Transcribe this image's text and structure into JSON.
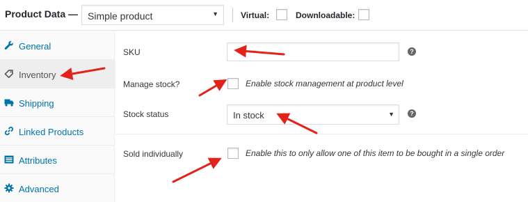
{
  "header": {
    "title": "Product Data —",
    "product_type": "Simple product",
    "virtual_label": "Virtual:",
    "downloadable_label": "Downloadable:"
  },
  "tabs": [
    {
      "label": "General",
      "icon": "wrench-icon"
    },
    {
      "label": "Inventory",
      "icon": "tag-icon"
    },
    {
      "label": "Shipping",
      "icon": "truck-icon"
    },
    {
      "label": "Linked Products",
      "icon": "link-icon"
    },
    {
      "label": "Attributes",
      "icon": "list-icon"
    },
    {
      "label": "Advanced",
      "icon": "gear-icon"
    }
  ],
  "active_tab": "Inventory",
  "fields": {
    "sku_label": "SKU",
    "manage_stock_label": "Manage stock?",
    "manage_stock_desc": "Enable stock management at product level",
    "stock_status_label": "Stock status",
    "stock_status_value": "In stock",
    "sold_individually_label": "Sold individually",
    "sold_individually_desc": "Enable this to only allow one of this item to be bought in a single order"
  },
  "colors": {
    "link": "#0073aa",
    "annotation_arrow": "#e2231a",
    "help_icon": "#666666"
  }
}
